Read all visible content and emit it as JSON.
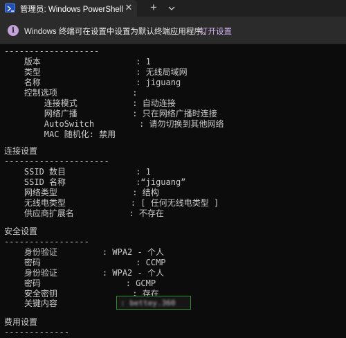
{
  "titlebar": {
    "tab_title": "管理员: Windows PowerShell",
    "close_glyph": "✕",
    "new_tab_glyph": "+",
    "tab_icon": "powershell-icon",
    "dropdown_icon": "chevron-down-icon"
  },
  "infobar": {
    "icon": "info-icon",
    "icon_glyph": "i",
    "message": "Windows 终端可在设置中设置为默认终端应用程序。",
    "link": "打开设置"
  },
  "terminal": {
    "lines": [
      "-------------------",
      "    版本                   : 1",
      "    类型                   : 无线局域网",
      "    名称                   : jiguang",
      "    控制选项               :",
      "        连接模式           : 自动连接",
      "        网络广播           : 只在网络广播时连接",
      "        AutoSwitch         : 请勿切换到其他网络",
      "        MAC 随机化: 禁用",
      "",
      "连接设置",
      "---------------------",
      "    SSID 数目              : 1",
      "    SSID 名称              :“jiguang”",
      "    网络类型               : 结构",
      "    无线电类型             : [ 任何无线电类型 ]",
      "    供应商扩展名           : 不存在",
      "",
      "安全设置",
      "-----------------",
      "    身份验证         : WPA2 - 个人",
      "    密码                   : CCMP",
      "    身份验证         : WPA2 - 个人",
      "    密码                 : GCMP",
      "    安全密钥               : 存在",
      "    关键内容",
      "",
      "费用设置",
      "-------------"
    ],
    "key_content_value": ": bettey.360"
  }
}
